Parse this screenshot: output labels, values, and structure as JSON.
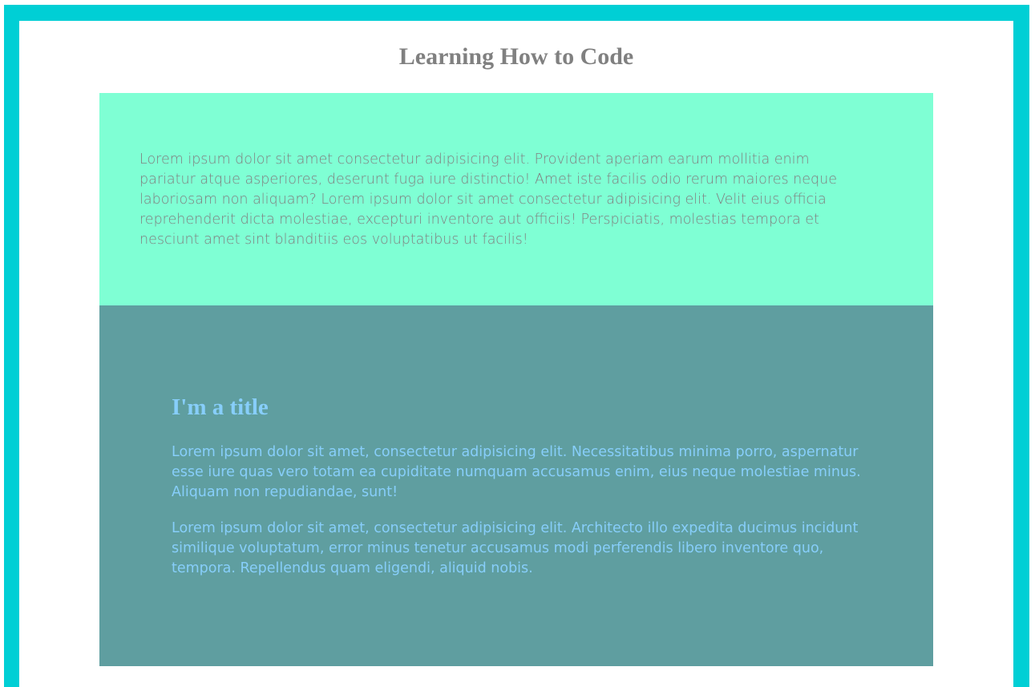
{
  "header": {
    "title": "Learning How to Code"
  },
  "intro": {
    "text": "Lorem ipsum dolor sit amet consectetur adipisicing elit. Provident aperiam earum mollitia enim pariatur atque asperiores, deserunt fuga iure distinctio! Amet iste facilis odio rerum maiores neque laboriosam non aliquam? Lorem ipsum dolor sit amet consectetur adipisicing elit. Velit eius officia reprehenderit dicta molestiae, excepturi inventore aut officiis! Perspiciatis, molestias tempora et nesciunt amet sint blanditiis eos voluptatibus ut facilis!"
  },
  "feature": {
    "title": "I'm a title",
    "paragraphs": [
      "Lorem ipsum dolor sit amet, consectetur adipisicing elit. Necessitatibus minima porro, aspernatur esse iure quas vero totam ea cupiditate numquam accusamus enim, eius neque molestiae minus. Aliquam non repudiandae, sunt!",
      "Lorem ipsum dolor sit amet, consectetur adipisicing elit. Architecto illo expedita ducimus incidunt similique voluptatum, error minus tenetur accusamus modi perferendis libero inventore quo, tempora. Repellendus quam eligendi, aliquid nobis."
    ]
  },
  "colors": {
    "frame_border": "#00cfd5",
    "intro_background": "#7fffd4",
    "feature_background": "#5f9ea0",
    "title_text": "#808080",
    "feature_text": "#87cefa"
  }
}
